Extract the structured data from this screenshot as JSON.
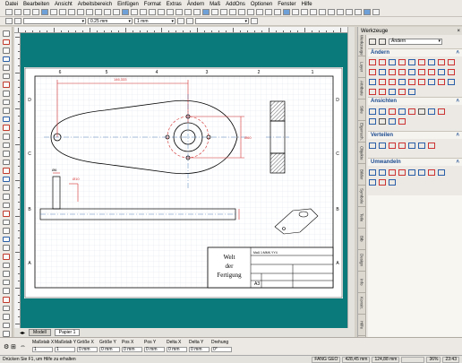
{
  "menu": [
    "Datei",
    "Bearbeiten",
    "Ansicht",
    "Arbeitsbereich",
    "Einfügen",
    "Format",
    "Extras",
    "Ändern",
    "Maß",
    "AddOns",
    "Optionen",
    "Fenster",
    "Hilfe"
  ],
  "toolbar": {
    "linewidth": "0.25 mm",
    "linetype": "1 mm"
  },
  "ruler": {
    "unit": "mm"
  },
  "drawing": {
    "frame_cols": [
      "6",
      "5",
      "4",
      "3",
      "2",
      "1"
    ],
    "frame_rows": [
      "D",
      "C",
      "B",
      "A"
    ],
    "dim_top": "146,333",
    "dim_right": "Ø60",
    "dim_small": "Ø6",
    "dim_side": "Ø10",
    "titleblock": {
      "name1": "Welt",
      "name2": "der",
      "name3": "Fertigung",
      "partno": "Maß 1:MMK.YY4",
      "size": "A3"
    }
  },
  "sheet_tabs": {
    "model": "Modell",
    "sheet": "Papier 1"
  },
  "panel": {
    "title": "Werkzeuge",
    "mode": "Ändern",
    "sections": [
      "Ändern",
      "Ansichten",
      "Verteilen",
      "Umwandeln"
    ],
    "side_tabs": [
      "Werkzeuge",
      "Layer",
      "Attribute",
      "Stile",
      "Eigensch.",
      "Objekte",
      "Bilder",
      "Symbole",
      "Teile",
      "Bib",
      "Design",
      "Info",
      "Konstr.",
      "Hilfe"
    ]
  },
  "properties": {
    "labels": [
      "Maßstab X",
      "Maßstab Y",
      "Größe X",
      "Größe Y",
      "Pos X",
      "Pos Y",
      "Delta X",
      "Delta Y",
      "Drehung"
    ],
    "values": [
      "1",
      "1",
      "0 mm",
      "0 mm",
      "0 mm",
      "0 mm",
      "0 mm",
      "0 mm",
      "0°"
    ]
  },
  "status": {
    "help": "Drücken Sie F1, um Hilfe zu erhalten",
    "mode": "FANG GEO",
    "x": "428,45 mm",
    "y": "124,88 mm",
    "zoom": "36%",
    "time": "23:43"
  },
  "colors": {
    "canvas": "#0b7a7a",
    "accent": "#1a4a8f",
    "drawing_red": "#d32f2f"
  }
}
